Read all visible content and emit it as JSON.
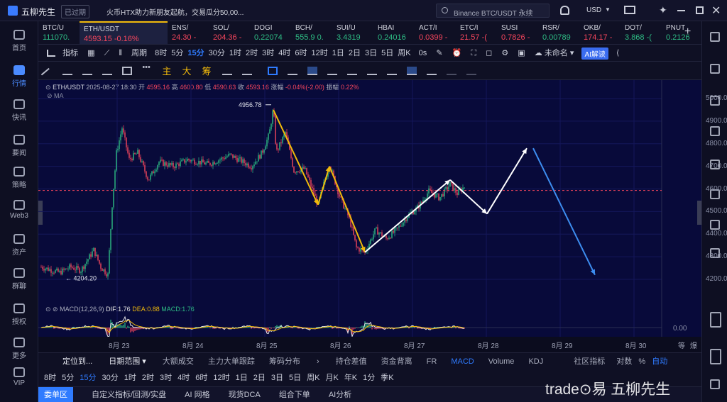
{
  "app": {
    "name": "五柳先生",
    "status": "已过期",
    "news": "火币HTX助力新朋友起航，交易瓜分50,00...",
    "search_placeholder": "Binance BTC/USDT 永续",
    "currency": "USD"
  },
  "sidebar": [
    {
      "label": "首页",
      "icon": "home-icon"
    },
    {
      "label": "行情",
      "icon": "market-icon"
    },
    {
      "label": "快讯",
      "icon": "news-icon"
    },
    {
      "label": "要闻",
      "icon": "headline-icon"
    },
    {
      "label": "策略",
      "icon": "strategy-icon"
    },
    {
      "label": "Web3",
      "icon": "web3-icon"
    },
    {
      "label": "资产",
      "icon": "asset-icon"
    },
    {
      "label": "群聊",
      "icon": "chat-icon"
    },
    {
      "label": "授权",
      "icon": "auth-icon"
    },
    {
      "label": "更多",
      "icon": "more-icon"
    },
    {
      "label": "VIP",
      "icon": "vip-icon"
    }
  ],
  "tickers": [
    {
      "sym": "BTC/U",
      "price": "111070.",
      "dir": "up"
    },
    {
      "sym": "ETH/USDT",
      "price": "4593.15",
      "change": "-0.16%",
      "dir": "down"
    },
    {
      "sym": "ENS/",
      "price": "24.30",
      "change": "-",
      "dir": "down"
    },
    {
      "sym": "SOL/",
      "price": "204.36",
      "change": "-",
      "dir": "down"
    },
    {
      "sym": "DOGI",
      "price": "0.22074",
      "dir": "up"
    },
    {
      "sym": "BCH/",
      "price": "555.9",
      "change": "0.",
      "dir": "up"
    },
    {
      "sym": "SUI/U",
      "price": "3.4319",
      "dir": "up"
    },
    {
      "sym": "HBAI",
      "price": "0.24016",
      "dir": "up"
    },
    {
      "sym": "ACT/I",
      "price": "0.0399",
      "change": "-",
      "dir": "down"
    },
    {
      "sym": "ETC/I",
      "price": "21.57",
      "change": "-(",
      "dir": "down"
    },
    {
      "sym": "SUSI",
      "price": "0.7826",
      "change": "-",
      "dir": "down"
    },
    {
      "sym": "RSR/",
      "price": "0.00789",
      "dir": "up"
    },
    {
      "sym": "OKB/",
      "price": "174.17",
      "change": "-",
      "dir": "down"
    },
    {
      "sym": "DOT/",
      "price": "3.868",
      "change": "-(",
      "dir": "up"
    },
    {
      "sym": "PNUT",
      "price": "0.2126",
      "dir": "up"
    }
  ],
  "toolbar": {
    "indicators": "指标",
    "period": "周期",
    "periods": [
      "8时",
      "5分",
      "15分",
      "30分",
      "1时",
      "2时",
      "3时",
      "4时",
      "6时",
      "12时",
      "1日",
      "2日",
      "3日",
      "5日",
      "周K"
    ],
    "active_period": "15分",
    "countdown": "0s",
    "layout": "未命名",
    "ai": "AI解读"
  },
  "drawtools": {
    "labels": [
      "主",
      "大",
      "筹"
    ]
  },
  "chart": {
    "pair": "ETH/USDT",
    "datetime": "2025-08-27 18:30",
    "open_label": "开",
    "open": "4595.16",
    "high_label": "高",
    "high": "4600.80",
    "low_label": "低",
    "low": "4590.63",
    "close_label": "收",
    "close": "4593.16",
    "chg_label": "涨幅",
    "chg": "-0.04%(-2.00)",
    "amp_label": "振幅",
    "amp": "0.22%",
    "ma": "MA",
    "high_mark": "4956.78",
    "low_mark": "4204.20",
    "y_ticks": [
      "5000.00",
      "4900.00",
      "4800.00",
      "4700.00",
      "4600.00",
      "4500.00",
      "4400.00",
      "4300.00",
      "4200.00"
    ],
    "x_ticks": [
      "8月 23",
      "8月 24",
      "8月 25",
      "8月 26",
      "8月 27",
      "8月 28",
      "8月 29",
      "8月 30"
    ],
    "current_price": 4593.15,
    "colors": {
      "up": "#2ebd85",
      "down": "#f6465d",
      "bg": "#080a3a"
    }
  },
  "macd": {
    "name": "MACD(12,26,9)",
    "dif_label": "DIF:",
    "dif": "1.76",
    "dea_label": "DEA:",
    "dea": "0.88",
    "macd_label": "MACD:",
    "macd": "1.76",
    "zero": "0.00"
  },
  "axis_extra": [
    "等",
    "爆"
  ],
  "bottomtabs": {
    "locate": "定位到...",
    "range": "日期范围",
    "items": [
      "大额成交",
      "主力大单跟踪",
      "筹码分布"
    ],
    "right": [
      "持仓差值",
      "资金背离",
      "FR",
      "MACD",
      "Volume",
      "KDJ"
    ],
    "active": "MACD",
    "zone": "社区指标",
    "log": "对数",
    "pct": "%",
    "auto": "自动"
  },
  "periodbar": [
    "8时",
    "5分",
    "15分",
    "30分",
    "1时",
    "2时",
    "3时",
    "4时",
    "6时",
    "12时",
    "1日",
    "2日",
    "3日",
    "5日",
    "周K",
    "月K",
    "年K",
    "1分",
    "季K"
  ],
  "panelbar": {
    "items": [
      "委单区",
      "自定义指标/回测/实盘",
      "AI 网格",
      "现货DCA",
      "组合下单",
      "AI分析"
    ],
    "active": "委单区"
  },
  "watermark": "trade⊙易 五柳先生"
}
